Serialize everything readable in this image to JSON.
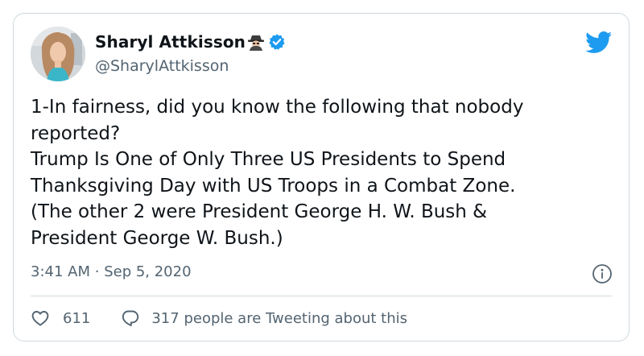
{
  "author": {
    "display_name": "Sharyl Attkisson",
    "handle": "@SharylAttkisson"
  },
  "tweet": {
    "lines": [
      "1-In fairness, did you know the following that nobody",
      "reported?",
      "Trump Is One of Only Three US Presidents to Spend",
      "Thanksgiving Day with US Troops in a Combat Zone.",
      "(The other 2 were President George H. W. Bush &",
      "President George W. Bush.)"
    ],
    "time": "3:41 AM",
    "separator": "·",
    "date": "Sep 5, 2020"
  },
  "actions": {
    "like_count": "611",
    "conversation_text": "317 people are Tweeting about this"
  },
  "icons": {
    "brand": "twitter-bird-icon",
    "verified": "verified-badge-icon",
    "emoji": "sleuth-spy-emoji",
    "info": "info-icon",
    "like": "heart-icon",
    "reply": "speech-bubble-icon"
  },
  "colors": {
    "twitter_blue": "#1d9bf0",
    "text": "#0f1419",
    "secondary": "#536471",
    "border": "#cfd9de"
  }
}
